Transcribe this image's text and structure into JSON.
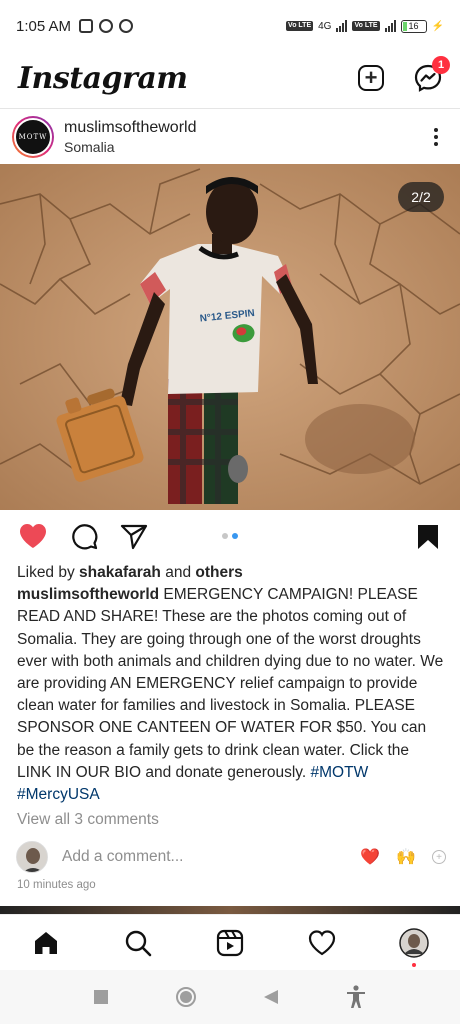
{
  "status_bar": {
    "time": "1:05 AM",
    "network_label": "4G",
    "volte_1": "Vo LTE",
    "volte_2": "Vo LTE",
    "battery": "16"
  },
  "header": {
    "logo": "Instagram",
    "messenger_badge": "1"
  },
  "post": {
    "avatar_text": "MOTW",
    "username": "muslimsoftheworld",
    "location": "Somalia",
    "image_counter": "2/2",
    "carousel_index": 2,
    "carousel_total": 2,
    "liked_prefix": "Liked by ",
    "liked_user": "shakafarah",
    "liked_and": " and ",
    "liked_others": "others",
    "caption_user": "muslimsoftheworld",
    "caption_text": " EMERGENCY CAMPAIGN! PLEASE READ AND SHARE! These are the photos coming out of Somalia. They are going through one of the worst droughts ever with both animals and children dying due to no water. We are providing AN EMERGENCY relief campaign to provide clean water for families and livestock in Somalia. PLEASE SPONSOR ONE CANTEEN OF WATER FOR $50. You can be the reason a family gets to drink clean water. Click the LINK IN OUR BIO and donate generously. ",
    "hashtag_1": "#MOTW",
    "hashtag_2": "#MercyUSA",
    "view_comments": "View all 3 comments",
    "add_comment_placeholder": "Add a comment...",
    "quick_reaction_1": "❤️",
    "quick_reaction_2": "🙌",
    "time_ago": "10 minutes ago"
  },
  "colors": {
    "like_red": "#ed4956",
    "badge_red": "#ff3040",
    "dot_active": "#3897f0",
    "hashtag": "#00376b"
  },
  "bottom_nav": [
    "home-icon",
    "search-icon",
    "reels-icon",
    "heart-icon",
    "profile-avatar"
  ]
}
